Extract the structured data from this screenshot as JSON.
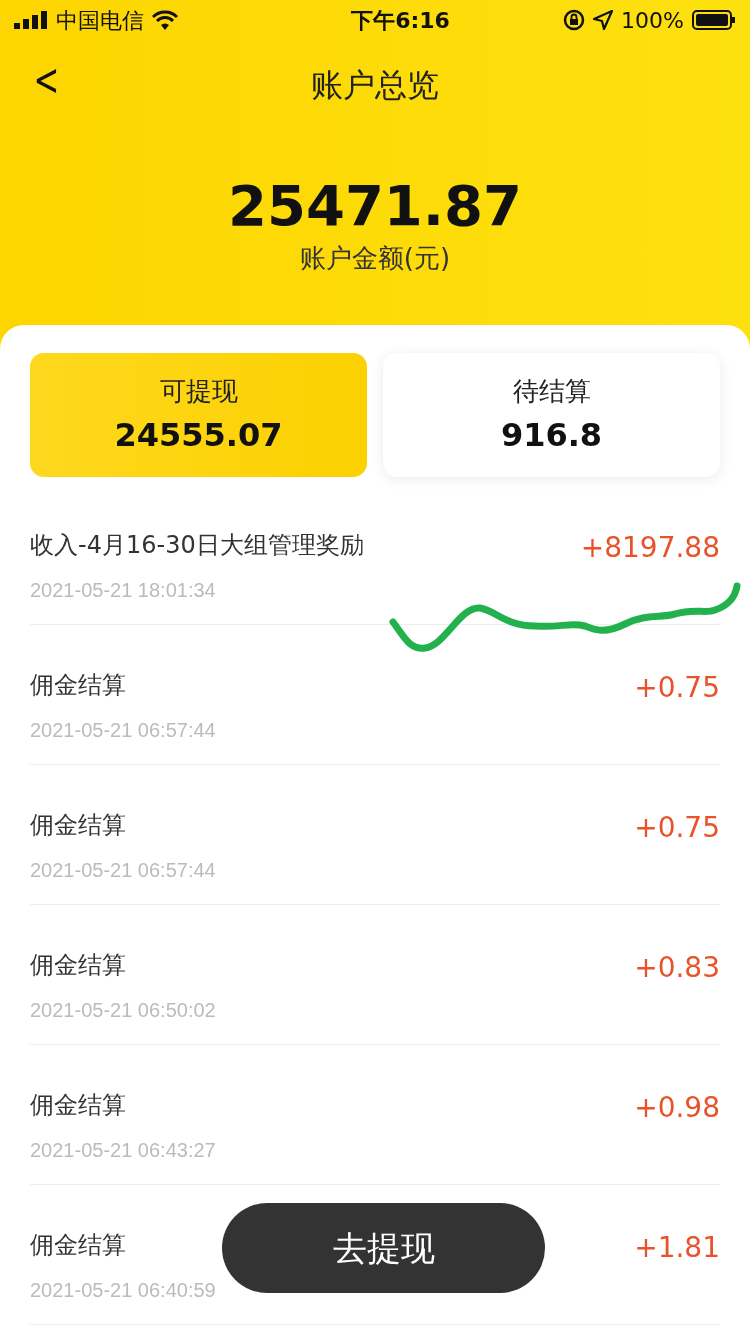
{
  "status_bar": {
    "carrier": "中国电信",
    "time": "下午6:16",
    "battery": "100%"
  },
  "header": {
    "title": "账户总览",
    "back": "<"
  },
  "balance": {
    "amount": "25471.87",
    "label": "账户金额(元)"
  },
  "tabs": [
    {
      "label": "可提现",
      "value": "24555.07",
      "selected": true
    },
    {
      "label": "待结算",
      "value": "916.8",
      "selected": false
    }
  ],
  "records": [
    {
      "title": "收入-4月16-30日大组管理奖励",
      "time": "2021-05-21 18:01:34",
      "amount": "+8197.88"
    },
    {
      "title": "佣金结算",
      "time": "2021-05-21 06:57:44",
      "amount": "+0.75"
    },
    {
      "title": "佣金结算",
      "time": "2021-05-21 06:57:44",
      "amount": "+0.75"
    },
    {
      "title": "佣金结算",
      "time": "2021-05-21 06:50:02",
      "amount": "+0.83"
    },
    {
      "title": "佣金结算",
      "time": "2021-05-21 06:43:27",
      "amount": "+0.98"
    },
    {
      "title": "佣金结算",
      "time": "2021-05-21 06:40:59",
      "amount": "+1.81"
    }
  ],
  "action_button": "去提现"
}
